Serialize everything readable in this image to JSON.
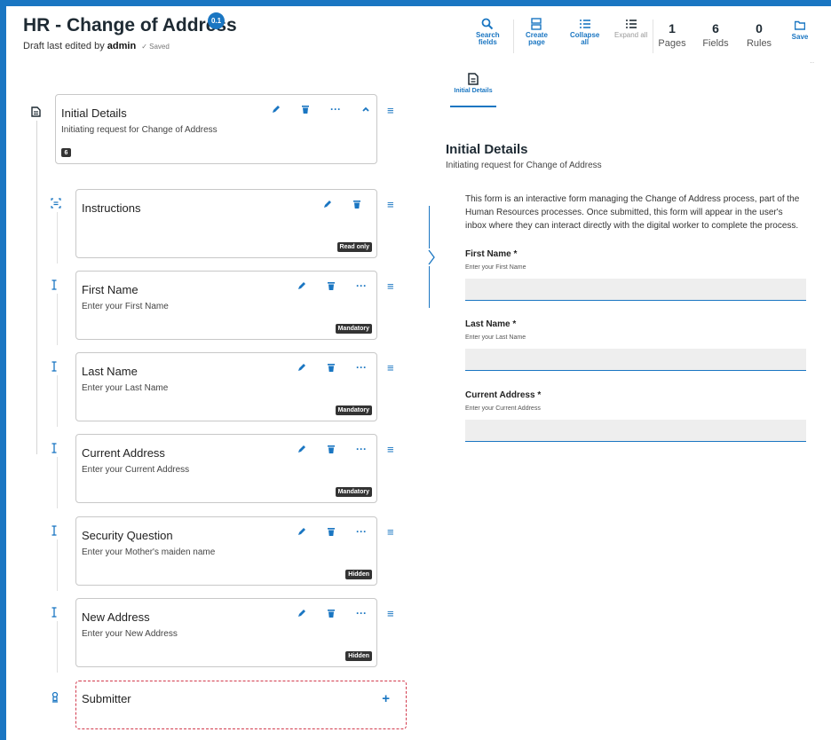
{
  "header": {
    "title": "HR - Change of Address",
    "version": "0.1",
    "draft_prefix": "Draft last edited by ",
    "editor": "admin",
    "status": "Saved"
  },
  "toolbar": {
    "search_line1": "Search",
    "search_line2": "fields",
    "create_line1": "Create",
    "create_line2": "page",
    "collapse_line1": "Collapse",
    "collapse_line2": "all",
    "expand_all": "Expand all",
    "save": "Save"
  },
  "stats": {
    "pages_value": "1",
    "pages_label": "Pages",
    "fields_value": "6",
    "fields_label": "Fields",
    "rules_value": "0",
    "rules_label": "Rules"
  },
  "builder": {
    "page_card": {
      "title": "Initial Details",
      "description": "Initiating request for Change of Address",
      "field_count": "6"
    },
    "fields": [
      {
        "title": "Instructions",
        "description": "",
        "badge": "Read only"
      },
      {
        "title": "First Name",
        "description": "Enter your First Name",
        "badge": "Mandatory"
      },
      {
        "title": "Last Name",
        "description": "Enter your Last Name",
        "badge": "Mandatory"
      },
      {
        "title": "Current Address",
        "description": "Enter your Current Address",
        "badge": "Mandatory"
      },
      {
        "title": "Security Question",
        "description": "Enter your Mother's maiden name",
        "badge": "Hidden"
      },
      {
        "title": "New Address",
        "description": "Enter your New Address",
        "badge": "Hidden"
      }
    ],
    "submitter": {
      "title": "Submitter"
    }
  },
  "preview": {
    "tab_label": "Initial Details",
    "title": "Initial Details",
    "description": "Initiating request for Change of Address",
    "intro": "This form is an interactive form managing the Change of Address process, part of the Human Resources processes. Once submitted, this form will appear in the user's inbox where they can interact directly with the digital worker to complete the process.",
    "fields": [
      {
        "label": "First Name *",
        "hint": "Enter your First Name",
        "value": ""
      },
      {
        "label": "Last Name *",
        "hint": "Enter your Last Name",
        "value": ""
      },
      {
        "label": "Current Address *",
        "hint": "Enter your Current Address",
        "value": ""
      }
    ]
  },
  "colors": {
    "accent": "#1a76c2",
    "badge_bg": "#333333",
    "submitter_border": "#d23a4d"
  },
  "icons": {
    "search": "search-icon",
    "create": "create-page-icon",
    "collapse": "collapse-all-icon",
    "expand": "expand-all-icon",
    "save": "folder-icon",
    "edit": "pencil-icon",
    "delete": "trash-icon",
    "more": "more-dots-icon",
    "drag": "hamburger-drag-icon"
  }
}
